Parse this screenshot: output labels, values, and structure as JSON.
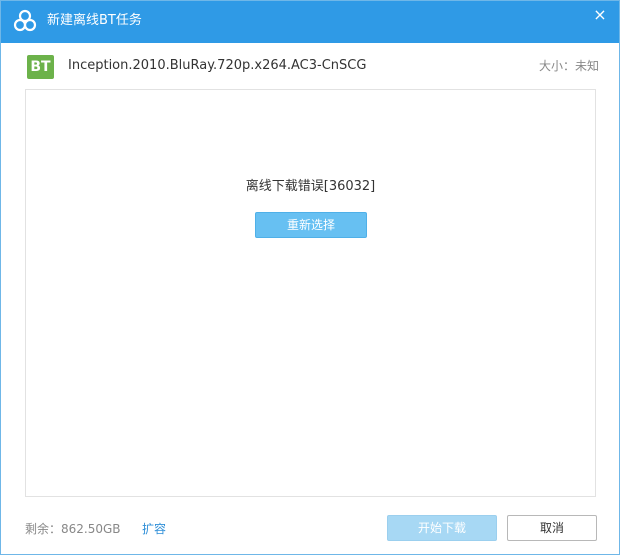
{
  "window": {
    "title": "新建离线BT任务",
    "close_glyph": "×",
    "accent_color": "#2f9ae6"
  },
  "file": {
    "icon_label": "BT",
    "icon_name": "bt-file-icon",
    "icon_color": "#6cb24a",
    "name": "Inception.2010.BluRay.720p.x264.AC3-CnSCG",
    "size_text": "大小：未知"
  },
  "main": {
    "error_message": "离线下载错误[36032]",
    "reselect_label": "重新选择"
  },
  "footer": {
    "remaining_space": "剩余：862.50GB",
    "expand_label": "扩容",
    "start_label": "开始下载",
    "start_enabled": false,
    "cancel_label": "取消"
  }
}
